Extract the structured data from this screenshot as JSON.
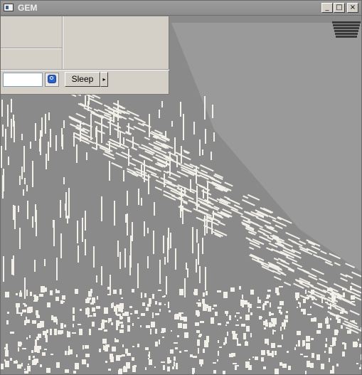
{
  "window": {
    "title": "GEM",
    "controls": {
      "minimize": "_",
      "maximize": "□",
      "close": "×"
    }
  },
  "toolbar": {
    "search_value": "",
    "sleep_label": "Sleep",
    "sleep_menu_arrow": "▸"
  },
  "icons": {
    "app": "app-window-icon",
    "search": "search-magnifier-icon"
  },
  "colors": {
    "background": "#808080",
    "panel": "#d4d0c8",
    "streak": "#f2f0e8"
  }
}
